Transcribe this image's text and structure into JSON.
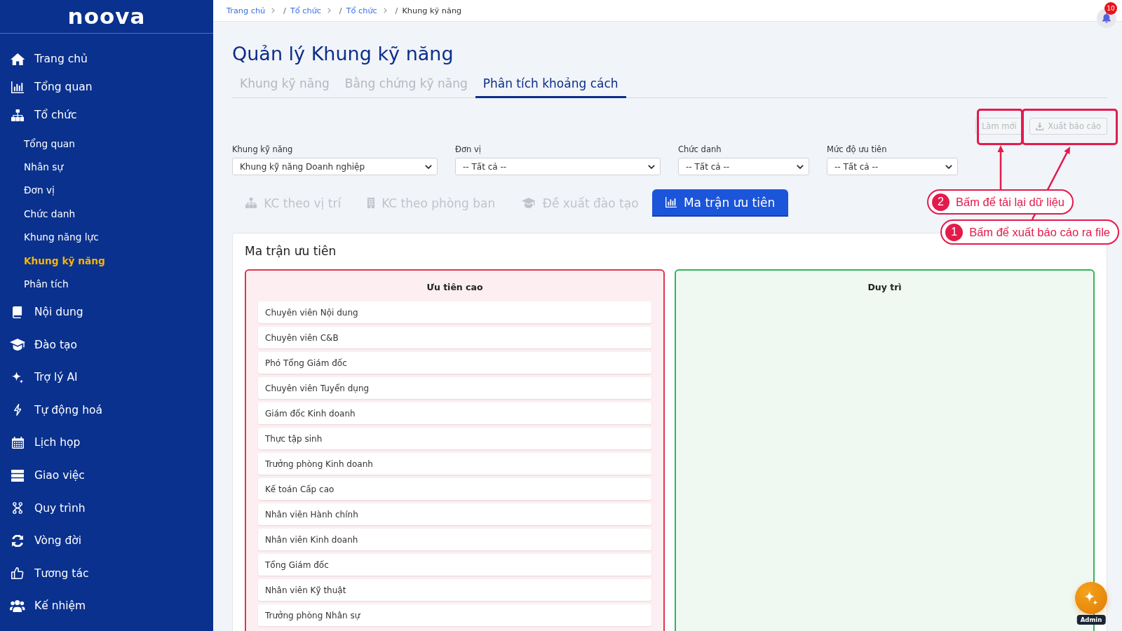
{
  "sidebar": {
    "logo": "noova",
    "items": [
      {
        "label": "Trang chủ",
        "selected": false
      },
      {
        "label": "Tổng quan",
        "selected": false
      },
      {
        "label": "Tổ chức",
        "selected": false,
        "children": [
          {
            "label": "Tổng quan",
            "selected": false
          },
          {
            "label": "Nhân sự",
            "selected": false
          },
          {
            "label": "Đơn vị",
            "selected": false
          },
          {
            "label": "Chức danh",
            "selected": false
          },
          {
            "label": "Khung năng lực",
            "selected": false
          },
          {
            "label": "Khung kỹ năng",
            "selected": true
          },
          {
            "label": "Phân tích",
            "selected": false
          }
        ]
      },
      {
        "label": "Nội dung",
        "selected": false
      },
      {
        "label": "Đào tạo",
        "selected": false
      },
      {
        "label": "Trợ lý AI",
        "selected": false
      },
      {
        "label": "Tự động hoá",
        "selected": false
      },
      {
        "label": "Lịch họp",
        "selected": false
      },
      {
        "label": "Giao việc",
        "selected": false
      },
      {
        "label": "Quy trình",
        "selected": false
      },
      {
        "label": "Vòng đời",
        "selected": false
      },
      {
        "label": "Tương tác",
        "selected": false
      },
      {
        "label": "Kế nhiệm",
        "selected": false
      }
    ]
  },
  "breadcrumb": [
    {
      "label": "Trang chủ",
      "current": false
    },
    {
      "separator": "/",
      "label": "Tổ chức",
      "current": false
    },
    {
      "separator": "/",
      "label": "Tổ chức",
      "current": false
    },
    {
      "separator": "/",
      "label": "Khung kỹ năng",
      "current": true
    }
  ],
  "notifications": {
    "count": "10"
  },
  "page_title": "Quản lý Khung kỹ năng",
  "tabs": [
    {
      "label": "Khung kỹ năng",
      "selected": false
    },
    {
      "label": "Bằng chứng kỹ năng",
      "selected": false
    },
    {
      "label": "Phân tích khoảng cách",
      "selected": true
    }
  ],
  "toolbar": {
    "buttons": [
      {
        "kind": "refresh",
        "label": "Làm mới",
        "disabled": true
      },
      {
        "kind": "export",
        "label": "Xuất báo cáo",
        "disabled": true
      }
    ]
  },
  "filters": [
    {
      "label": "Khung kỹ năng",
      "value": "Khung kỹ năng Doanh nghiệp"
    },
    {
      "label": "Đơn vị",
      "value": "-- Tất cả --"
    },
    {
      "label": "Chức danh",
      "value": "-- Tất cả --"
    },
    {
      "label": "Mức độ ưu tiên",
      "value": "-- Tất cả --"
    }
  ],
  "view_tabs": [
    {
      "label": "KC theo vị trí",
      "selected": false
    },
    {
      "label": "KC theo phòng ban",
      "selected": false
    },
    {
      "label": "Đề xuất đào tạo",
      "selected": false
    },
    {
      "label": "Ma trận ưu tiên",
      "selected": true
    }
  ],
  "matrix": {
    "title": "Ma trận ưu tiên",
    "quadrants": [
      {
        "title": "Ưu tiên cao",
        "color": "#e0344f",
        "items": [
          "Chuyên viên Nội dung",
          "Chuyên viên C&B",
          "Phó Tổng Giám đốc",
          "Chuyên viên Tuyển dụng",
          "Giám đốc Kinh doanh",
          "Thực tập sinh",
          "Trưởng phòng Kinh doanh",
          "Kế toán Cấp cao",
          "Nhân viên Hành chính",
          "Nhân viên Kinh doanh",
          "Tổng Giám đốc",
          "Nhân viên Kỹ thuật",
          "Trưởng phòng Nhân sự"
        ]
      },
      {
        "title": "Duy trì",
        "color": "#34b35a"
      }
    ]
  },
  "assistant": {
    "label": "Admin"
  },
  "annotations": [
    {
      "number": "2",
      "text": "Bấm để tải lại dữ liệu"
    },
    {
      "number": "1",
      "text": "Bấm để xuất báo cáo ra file"
    }
  ]
}
